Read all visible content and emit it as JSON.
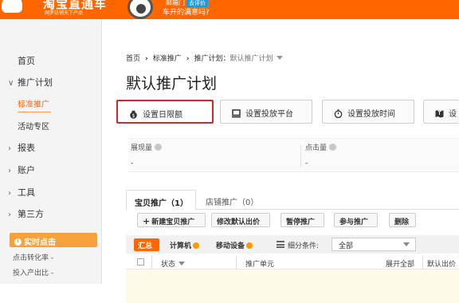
{
  "header": {
    "logo_title": "淘宝直通车",
    "logo_sub": "网罗热销天下产品",
    "promo_text": "邮箱门",
    "promo_badge": "去评价",
    "promo_question": "车开的满意吗?"
  },
  "sidebar": {
    "home": "首页",
    "promo_plan": "推广计划",
    "standard_promo": "标准推广",
    "activity_zone": "活动专区",
    "reports": "报表",
    "account": "账户",
    "tools": "工具",
    "third_party": "第三方",
    "realtime_title": "实时点击",
    "click_conv_label": "点击转化率 -",
    "roi_label": "投入产出比 -"
  },
  "breadcrumb": {
    "home": "首页",
    "standard_promo": "标准推广",
    "plan_prefix": "推广计划：",
    "plan_name": "默认推广计划"
  },
  "page_title": "默认推广计划",
  "toolbar": {
    "daily_limit": "设置日限额",
    "platform": "设置投放平台",
    "time": "设置投放时间",
    "region": "设"
  },
  "stats": {
    "impressions_label": "展现量",
    "impressions_value": "-",
    "clicks_label": "点击量",
    "clicks_value": "-"
  },
  "tabs": {
    "product": "宝贝推广（1）",
    "shop": "店铺推广（0）"
  },
  "actions": {
    "new": "新建宝贝推广",
    "edit_bid": "修改默认出价",
    "pause": "暂停推广",
    "join": "参与推广",
    "delete": "删除"
  },
  "filter": {
    "summary": "汇总",
    "computer": "计算机",
    "mobile": "移动设备",
    "condition_label": "细分条件:",
    "condition_value": "全部"
  },
  "table": {
    "status": "状态",
    "unit": "推广单元",
    "expand_all": "展开全部",
    "default_bid": "默认出价"
  },
  "colors": {
    "brand_orange": "#ff6600",
    "highlight_red": "#d8232a",
    "realtime_orange": "#f7a13a"
  }
}
